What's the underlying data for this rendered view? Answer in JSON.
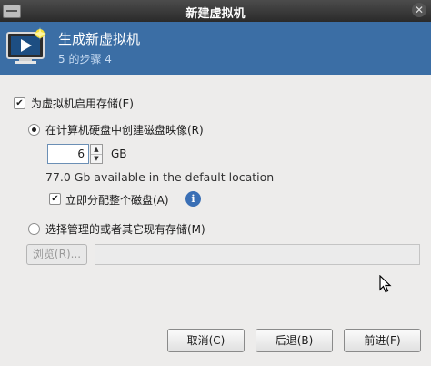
{
  "window": {
    "title": "新建虚拟机",
    "close_glyph": "✕"
  },
  "header": {
    "title": "生成新虚拟机",
    "step": "5 的步骤 4"
  },
  "storage": {
    "enable_label": "为虚拟机启用存储(E)",
    "enable_checked": true,
    "create_disk_label": "在计算机硬盘中创建磁盘映像(R)",
    "create_disk_selected": true,
    "size_value": "6",
    "size_unit": "GB",
    "available_text": "77.0 Gb available in the default location",
    "allocate_label": "立即分配整个磁盘(A)",
    "allocate_checked": true,
    "info_glyph": "i",
    "existing_label": "选择管理的或者其它现有存储(M)",
    "existing_selected": false,
    "browse_label": "浏览(R)...",
    "path_value": ""
  },
  "buttons": {
    "cancel": "取消(C)",
    "back": "后退(B)",
    "forward": "前进(F)"
  },
  "icons": {
    "header": "computer-monitor-icon",
    "info": "info-icon",
    "cursor": "mouse-pointer-icon"
  },
  "colors": {
    "header_bg": "#3b6ea5",
    "titlebar_bg": "#2f2f2f",
    "dialog_bg": "#edeceb",
    "info_blue": "#3a6fb5"
  }
}
